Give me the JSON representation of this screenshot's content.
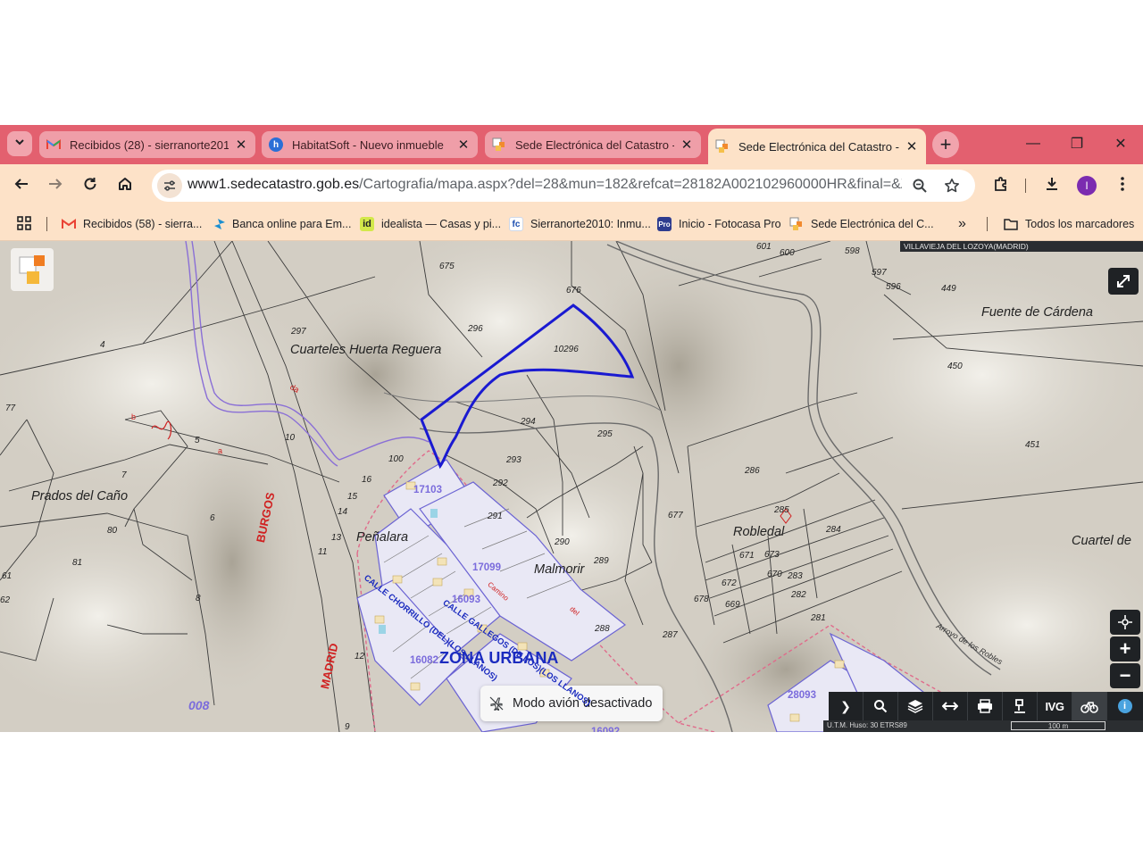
{
  "browser": {
    "tabs": [
      {
        "title": "Recibidos (28) - sierranorte2010@",
        "favicon": "gmail-icon",
        "active": false
      },
      {
        "title": "HabitatSoft - Nuevo inmueble",
        "favicon": "habitatsoft-icon",
        "active": false
      },
      {
        "title": "Sede Electrónica del Catastro - F",
        "favicon": "catastro-icon",
        "active": false
      },
      {
        "title": "Sede Electrónica del Catastro - F",
        "favicon": "catastro-icon",
        "active": true
      }
    ],
    "new_tab_label": "+",
    "window_controls": {
      "minimize": "—",
      "maximize": "❐",
      "close": "✕"
    },
    "url": {
      "host": "www1.sedecatastro.gob.es",
      "path": "/Cartografia/mapa.aspx?del=28&mun=182&refcat=28182A002102960000HR&final=&ZV=..."
    },
    "avatar_letter": "I",
    "bookmarks": [
      {
        "label": "Recibidos (58) - sierra...",
        "icon": "gmail-icon"
      },
      {
        "label": "Banca online para Em...",
        "icon": "caixabank-icon"
      },
      {
        "label": "idealista — Casas y pi...",
        "icon": "idealista-icon"
      },
      {
        "label": "Sierranorte2010: Inmu...",
        "icon": "fotocasa-fc-icon"
      },
      {
        "label": "Inicio - Fotocasa Pro",
        "icon": "fotocasa-pro-icon"
      },
      {
        "label": "Sede Electrónica del C...",
        "icon": "catastro-icon"
      }
    ],
    "bookmarks_overflow": "»",
    "all_bookmarks_label": "Todos los marcadores"
  },
  "map": {
    "municipality_label": "VILLAVIEJA DEL LOZOYA(MADRID)",
    "place_names": {
      "cuarteles": "Cuarteles Huerta Reguera",
      "fuente": "Fuente de Cárdena",
      "prados": "Prados del Caño",
      "penalara": "Peñalara",
      "malmorir": "Malmorir",
      "robledal": "Robledal",
      "cuartel": "Cuartel de",
      "zona_urbana": "ZONA URBANA",
      "calle_gallegos": "CALLE GALLEGOS (DE LOS)(LOS LLANOS)",
      "calle_chorrillo": "CALLE CHORRILLO (DEL)(LOS LLANOS)",
      "burgos": "BURGOS",
      "madrid": "MADRID",
      "arroyo": "Arroyo de los Robles"
    },
    "parcels": {
      "p675": "675",
      "p676": "676",
      "p296": "296",
      "p10296": "10296",
      "p297": "297",
      "p294": "294",
      "p295": "295",
      "p293": "293",
      "p292": "292",
      "p291": "291",
      "p290": "290",
      "p289": "289",
      "p288": "288",
      "p287": "287",
      "p286": "286",
      "p285": "285",
      "p284": "284",
      "p283": "283",
      "p282": "282",
      "p281": "281",
      "p677": "677",
      "p678": "678",
      "p669": "669",
      "p670": "670",
      "p671": "671",
      "p672": "672",
      "p673": "673",
      "p601": "601",
      "p600": "600",
      "p598": "598",
      "p597": "597",
      "p596": "596",
      "p449": "449",
      "p450": "450",
      "p451": "451",
      "p4": "4",
      "p77": "77",
      "p5": "5",
      "p7": "7",
      "p6": "6",
      "p8": "8",
      "p80": "80",
      "p81": "81",
      "p61": "61",
      "p62": "62",
      "p10": "10",
      "p100": "100",
      "p16": "16",
      "p15": "15",
      "p14": "14",
      "p13": "13",
      "p11": "11",
      "p12": "12",
      "p9": "9",
      "p008": "008",
      "b17103": "17103",
      "b17099": "17099",
      "b16093": "16093",
      "b16082": "16082",
      "b28093": "28093",
      "b16092": "16092"
    },
    "red_labels": {
      "a": "a",
      "b": "b",
      "da": "da",
      "camino": "Camino",
      "del": "del"
    },
    "toast": "Modo avión desactivado",
    "toolbar_buttons": [
      {
        "name": "expand-toolbar-icon",
        "glyph": "❯"
      },
      {
        "name": "search-icon",
        "glyph": "⌕"
      },
      {
        "name": "layers-icon",
        "glyph": "≋"
      },
      {
        "name": "measure-icon",
        "glyph": "⟷"
      },
      {
        "name": "print-icon",
        "glyph": "⎙"
      },
      {
        "name": "parcel-query-icon",
        "glyph": "☊"
      },
      {
        "name": "ivg-label",
        "glyph": "IVG"
      },
      {
        "name": "bike-icon",
        "glyph": "⚲"
      },
      {
        "name": "info-icon",
        "glyph": "i"
      }
    ],
    "scale_text": "100 m",
    "projection_text": "U.T.M. Huso: 30 ETRS89",
    "zoom_in": "+",
    "zoom_out": "−"
  }
}
